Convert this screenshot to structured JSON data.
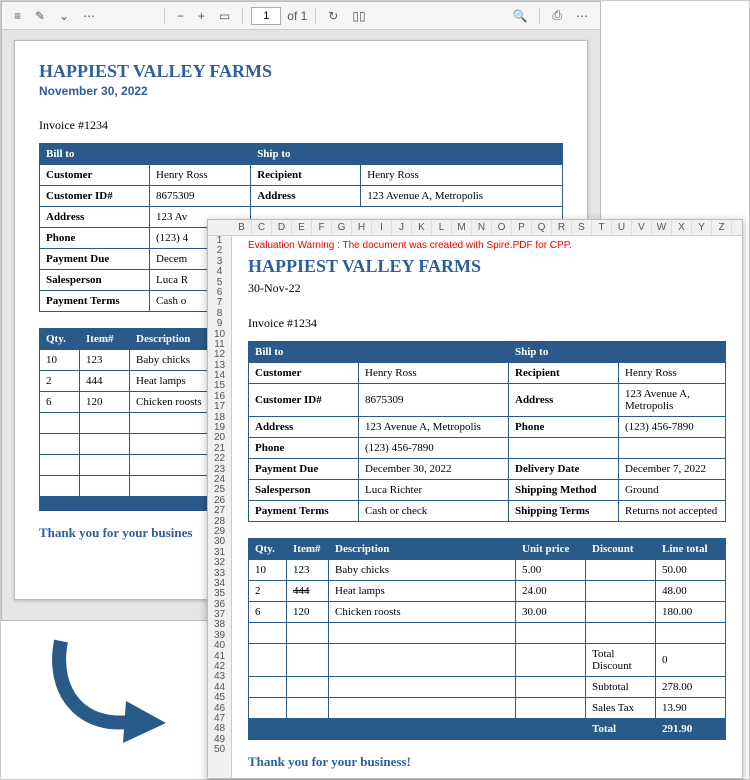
{
  "pdf": {
    "toolbar": {
      "page_current": "1",
      "page_of": "of 1"
    },
    "title": "HAPPIEST VALLEY FARMS",
    "date": "November 30, 2022",
    "invoice_no": "Invoice #1234",
    "bill_to_header": "Bill to",
    "ship_to_header": "Ship to",
    "bill": {
      "customer_label": "Customer",
      "customer": "Henry Ross",
      "custid_label": "Customer ID#",
      "custid": "8675309",
      "address_label": "Address",
      "address": "123 Av",
      "phone_label": "Phone",
      "phone": "(123) 4",
      "paydue_label": "Payment Due",
      "paydue": "Decem",
      "sales_label": "Salesperson",
      "sales": "Luca R",
      "terms_label": "Payment Terms",
      "terms": "Cash o"
    },
    "ship": {
      "recipient_label": "Recipient",
      "recipient": "Henry Ross",
      "address_label": "Address",
      "address": "123 Avenue A, Metropolis"
    },
    "items": {
      "qty": "Qty.",
      "item": "Item#",
      "desc": "Description",
      "rows": [
        {
          "qty": "10",
          "item": "123",
          "desc": "Baby chicks"
        },
        {
          "qty": "2",
          "item": "444",
          "desc": "Heat lamps"
        },
        {
          "qty": "6",
          "item": "120",
          "desc": "Chicken roosts"
        }
      ]
    },
    "thanks": "Thank you for your busines"
  },
  "xl": {
    "cols": [
      "B",
      "C",
      "D",
      "E",
      "F",
      "G",
      "H",
      "I",
      "J",
      "K",
      "L",
      "M",
      "N",
      "O",
      "P",
      "Q",
      "R",
      "S",
      "T",
      "U",
      "V",
      "W",
      "X",
      "Y",
      "Z"
    ],
    "rows_start": 1,
    "rows_end": 50,
    "warning": "Evaluation Warning : The document was created with Spire.PDF for CPP.",
    "title": "HAPPIEST VALLEY FARMS",
    "date": "30-Nov-22",
    "invoice_no": "Invoice #1234",
    "bill_to_header": "Bill to",
    "ship_to_header": "Ship to",
    "bill": {
      "customer_label": "Customer",
      "customer": "Henry Ross",
      "custid_label": "Customer ID#",
      "custid": "8675309",
      "address_label": "Address",
      "address": "123 Avenue A, Metropolis",
      "phone_label": "Phone",
      "phone": "(123) 456-7890",
      "paydue_label": "Payment Due",
      "paydue": "December 30, 2022",
      "sales_label": "Salesperson",
      "sales": "Luca Richter",
      "terms_label": "Payment Terms",
      "terms": "Cash or check"
    },
    "ship": {
      "recipient_label": "Recipient",
      "recipient": "Henry Ross",
      "address_label": "Address",
      "address": "123 Avenue A, Metropolis",
      "phone_label": "Phone",
      "phone": "(123) 456-7890",
      "delivery_label": "Delivery Date",
      "delivery": "December 7, 2022",
      "method_label": "Shipping Method",
      "method": "Ground",
      "shipterms_label": "Shipping Terms",
      "shipterms": "Returns not accepted"
    },
    "items": {
      "qty": "Qty.",
      "item": "Item#",
      "desc": "Description",
      "unit": "Unit price",
      "disc": "Discount",
      "linetot": "Line total",
      "rows": [
        {
          "qty": "10",
          "item": "123",
          "desc": "Baby chicks",
          "unit": "5.00",
          "disc": "",
          "linetot": "50.00"
        },
        {
          "qty": "2",
          "item": "444",
          "desc": "Heat lamps",
          "unit": "24.00",
          "disc": "",
          "linetot": "48.00"
        },
        {
          "qty": "6",
          "item": "120",
          "desc": "Chicken roosts",
          "unit": "30.00",
          "disc": "",
          "linetot": "180.00"
        }
      ],
      "totaldisc_label": "Total Discount",
      "totaldisc": "0",
      "subtotal_label": "Subtotal",
      "subtotal": "278.00",
      "tax_label": "Sales Tax",
      "tax": "13.90",
      "total_label": "Total",
      "total": "291.90"
    },
    "thanks": "Thank you for your business!"
  }
}
